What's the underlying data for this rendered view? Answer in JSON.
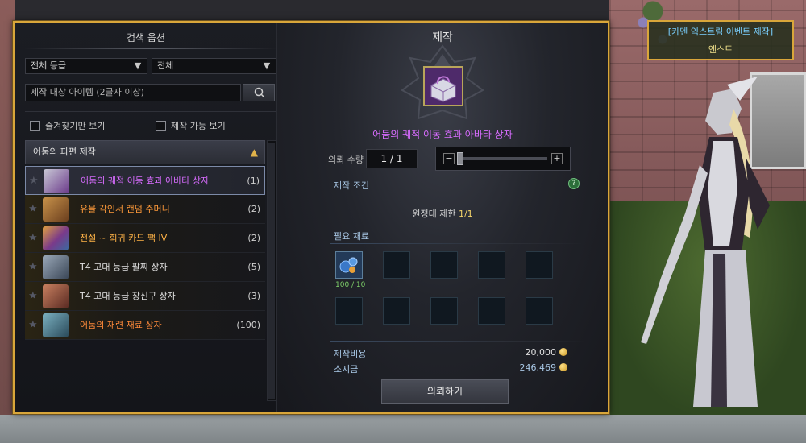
{
  "search": {
    "title": "검색 옵션",
    "grade_select": "전체 등급",
    "type_select": "전체",
    "placeholder": "제작 대상 아이템 (2글자 이상)",
    "favorites_label": "즐겨찾기만 보기",
    "craftable_label": "제작 가능 보기"
  },
  "category": {
    "label": "어둠의 파편 제작"
  },
  "items": [
    {
      "name": "어둠의 궤적 이동 효과 아바타 상자",
      "count": "(1)",
      "color": "#d86cff",
      "thumb": "#6b3a8a"
    },
    {
      "name": "유물 각인서 랜덤 주머니",
      "count": "(2)",
      "color": "#ff9a3a",
      "thumb": "#8a5a2a"
    },
    {
      "name": "전설 ~ 희귀 카드 팩 IV",
      "count": "(2)",
      "color": "#ffb347",
      "thumb": "#7a3a8a"
    },
    {
      "name": "T4 고대 등급 팔찌 상자",
      "count": "(5)",
      "color": "#e0e0e0",
      "thumb": "#4a5a6a"
    },
    {
      "name": "T4 고대 등급 장신구 상자",
      "count": "(3)",
      "color": "#e0e0e0",
      "thumb": "#6a3a2a"
    },
    {
      "name": "어둠의 재련 재료 상자",
      "count": "(100)",
      "color": "#ff8a3a",
      "thumb": "#3a5a6a"
    }
  ],
  "craft": {
    "title": "제작",
    "item_name": "어둠의 궤적 이동 효과 아바타 상자",
    "qty_label": "의뢰 수량",
    "qty_value": "1 / 1",
    "qty_fraction": 0.0,
    "conditions_label": "제작 조건",
    "limit_prefix": "원정대 제한",
    "limit_value": "1/1",
    "materials_label": "필요 재료",
    "material_count": "100 / 10",
    "cost_label": "제작비용",
    "cost_value": "20,000",
    "owned_label": "소지금",
    "owned_value": "246,469",
    "request_button": "의뢰하기",
    "help": "?"
  },
  "npc": {
    "title": "[카멘 익스트림 이벤트 제작]",
    "name": "엔스트"
  },
  "colors": {
    "accent_gold": "#d9a63a",
    "epic_purple": "#d86cff",
    "money_blue": "#a9c8e6",
    "material_green": "#7ed06a"
  }
}
